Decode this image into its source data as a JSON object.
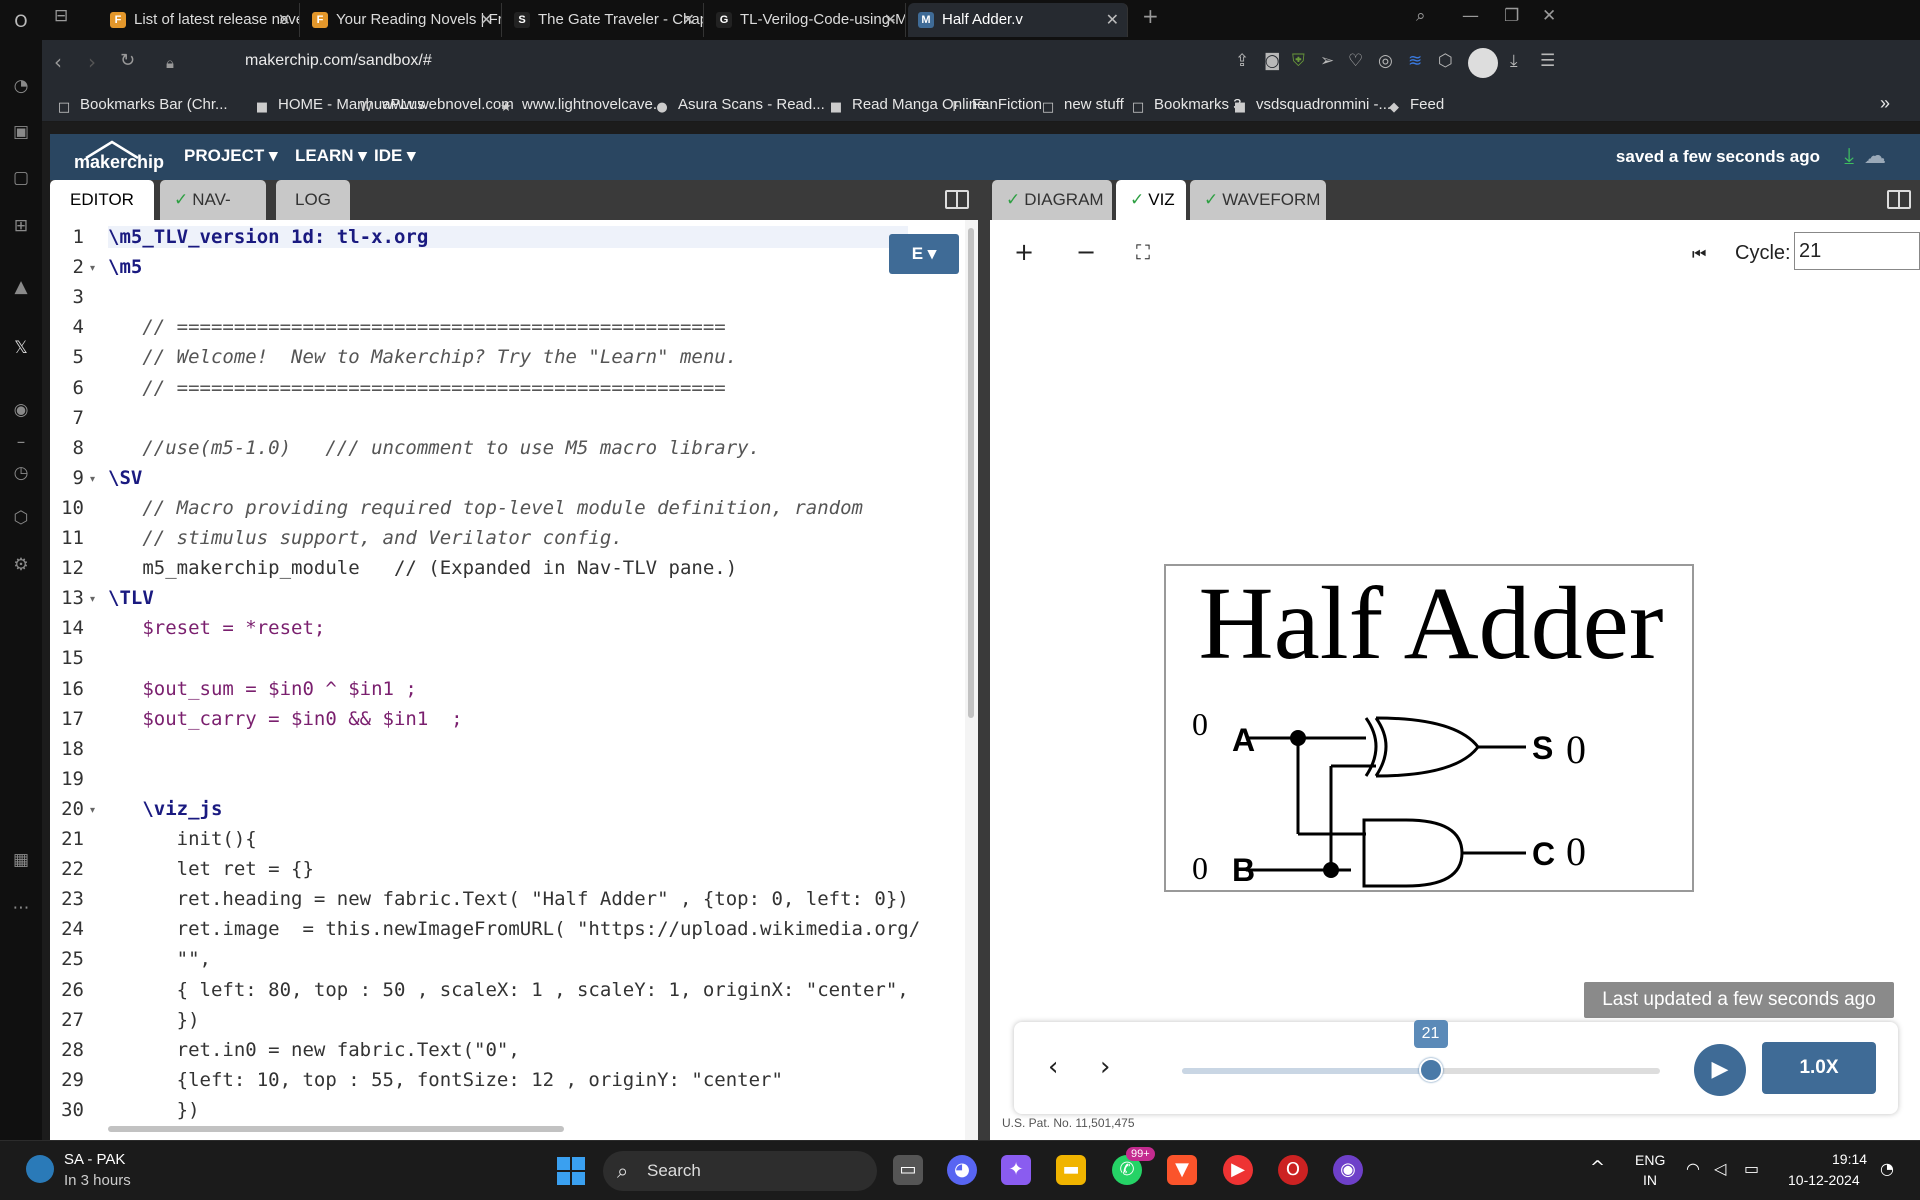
{
  "browser": {
    "tabs": [
      {
        "title": "List of latest release novels",
        "fav_color": "#e3972b",
        "fav": "F"
      },
      {
        "title": "Your Reading Novels | Free",
        "fav_color": "#e3972b",
        "fav": "F"
      },
      {
        "title": "The Gate Traveler - Chapter",
        "fav_color": "#222",
        "fav": "S"
      },
      {
        "title": "TL-Verilog-Code-using-Mak",
        "fav_color": "#222",
        "fav": "G"
      },
      {
        "title": "Half Adder.v",
        "fav_color": "#3f6b96",
        "fav": "M"
      }
    ],
    "new_tab": "+",
    "close_glyph": "✕",
    "url": "makerchip.com/sandbox/#",
    "bookmarks": [
      {
        "label": "Bookmarks Bar (Chr...",
        "icon": "□"
      },
      {
        "label": "HOME - ManhuaPLus",
        "icon": "■"
      },
      {
        "label": "www.webnovel.com",
        "icon": "W"
      },
      {
        "label": "www.lightnovelcave...",
        "icon": "★"
      },
      {
        "label": "Asura Scans - Read...",
        "icon": "●"
      },
      {
        "label": "Read Manga Online",
        "icon": "■"
      },
      {
        "label": "FanFiction",
        "icon": "F"
      },
      {
        "label": "new stuff",
        "icon": "□"
      },
      {
        "label": "Bookmarks 3",
        "icon": "□"
      },
      {
        "label": "vsdsquadronmini -...",
        "icon": "■"
      },
      {
        "label": "Feed",
        "icon": "◆"
      }
    ],
    "more_bookmarks": "»"
  },
  "app": {
    "logo": "makerchip",
    "menus": [
      "PROJECT ▾",
      "LEARN ▾",
      "IDE ▾"
    ],
    "saved_status": "saved a few seconds ago",
    "left_tabs": [
      {
        "label": "EDITOR",
        "check": ""
      },
      {
        "label": "NAV-TLV",
        "check": "✓"
      },
      {
        "label": "LOG",
        "check": ""
      }
    ],
    "right_tabs": [
      {
        "label": "DIAGRAM",
        "check": "✓"
      },
      {
        "label": "VIZ",
        "check": "✓"
      },
      {
        "label": "WAVEFORM",
        "check": "✓"
      }
    ],
    "editor_mode_button": "E ▾"
  },
  "code_lines": [
    "\\m5_TLV_version 1d: tl-x.org",
    "\\m5",
    "",
    "   // ================================================",
    "   // Welcome!  New to Makerchip? Try the \"Learn\" menu.",
    "   // ================================================",
    "",
    "   //use(m5-1.0)   /// uncomment to use M5 macro library.",
    "\\SV",
    "   // Macro providing required top-level module definition, random",
    "   // stimulus support, and Verilator config.",
    "   m5_makerchip_module   // (Expanded in Nav-TLV pane.)",
    "\\TLV",
    "   $reset = *reset;",
    "",
    "   $out_sum = $in0 ^ $in1 ;",
    "   $out_carry = $in0 && $in1  ;",
    "",
    "",
    "   \\viz_js",
    "      init(){",
    "      let ret = {}",
    "      ret.heading = new fabric.Text( \"Half Adder\" , {top: 0, left: 0})",
    "      ret.image  = this.newImageFromURL( \"https://upload.wikimedia.org/",
    "      \"\",",
    "      { left: 80, top : 50 , scaleX: 1 , scaleY: 1, originX: \"center\",",
    "      })",
    "      ret.in0 = new fabric.Text(\"0\",",
    "      {left: 10, top : 55, fontSize: 12 , originY: \"center\"",
    "      })"
  ],
  "viz": {
    "controls": [
      "+",
      "−",
      "⛶"
    ],
    "cycle_label": "Cycle:",
    "cycle_value": "21",
    "figure_title": "Half Adder",
    "input_a_value": "0",
    "input_a_label": "A",
    "input_b_value": "0",
    "input_b_label": "B",
    "sum_label": "S",
    "sum_value": "0",
    "carry_label": "C",
    "carry_value": "0",
    "last_updated": "Last updated a few seconds ago",
    "slider_value": "21",
    "slider_fraction": 0.52,
    "speed": "1.0X",
    "patent": "U.S. Pat. No. 11,501,475"
  },
  "taskbar": {
    "weather_line1": "SA - PAK",
    "weather_line2": "In 3 hours",
    "search": "Search",
    "lang1": "ENG",
    "lang2": "IN",
    "time": "19:14",
    "date": "10-12-2024",
    "badge": "99+"
  }
}
